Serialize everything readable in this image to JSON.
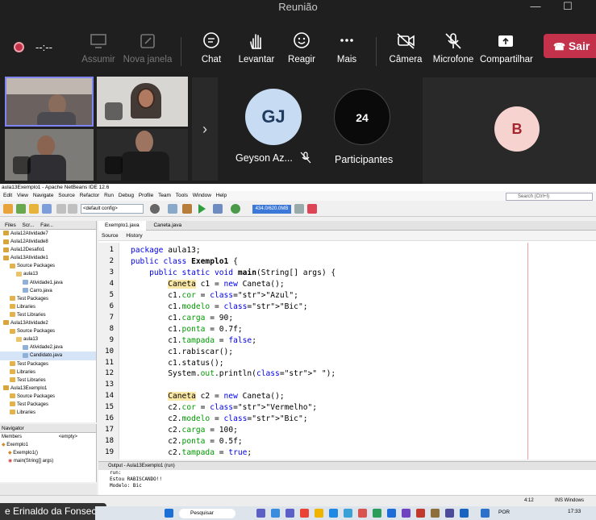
{
  "window": {
    "title": "Reunião",
    "minimize": "—",
    "maximize": "☐"
  },
  "toolbar": {
    "timer": "--:--",
    "buttons": [
      {
        "label": "Assumir",
        "icon": "screen-icon",
        "disabled": true
      },
      {
        "label": "Nova janela",
        "icon": "popout-icon",
        "disabled": true
      },
      {
        "label": "Chat",
        "icon": "chat-icon",
        "disabled": false
      },
      {
        "label": "Levantar",
        "icon": "hand-icon",
        "disabled": false
      },
      {
        "label": "Reagir",
        "icon": "smile-icon",
        "disabled": false
      },
      {
        "label": "Mais",
        "icon": "more-icon",
        "disabled": false
      },
      {
        "label": "Câmera",
        "icon": "camera-off-icon",
        "disabled": false
      },
      {
        "label": "Microfone",
        "icon": "mic-off-icon",
        "disabled": false
      },
      {
        "label": "Compartilhar",
        "icon": "share-icon",
        "disabled": false
      }
    ],
    "leave_label": "Sair"
  },
  "participants": {
    "tile1_initials": "GJ",
    "tile1_name": "Geyson Az...",
    "count": "24",
    "count_label": "Participantes",
    "tile3_initial": "B",
    "colors": {
      "gj_bg": "#c7dbf2",
      "gj_fg": "#1f3a5f",
      "count_bg": "#0a0a0a",
      "b_bg": "#f6d3cf",
      "b_fg": "#a4262c"
    }
  },
  "netbeans": {
    "title": "aula13Exemplo1 - Apache NetBeans IDE 12.6",
    "menu": [
      "Edit",
      "View",
      "Navigate",
      "Source",
      "Refactor",
      "Run",
      "Debug",
      "Profile",
      "Team",
      "Tools",
      "Window",
      "Help"
    ],
    "search_placeholder": "Search (Ctrl+I)",
    "config": "<default config>",
    "memory": "434.0/620.0MB",
    "tree_tabs": [
      "Files",
      "Scr...",
      "Fav..."
    ],
    "tree": [
      {
        "label": "Aula12Atividade7",
        "depth": 0,
        "kind": "project"
      },
      {
        "label": "Aula12Atividade8",
        "depth": 0,
        "kind": "project"
      },
      {
        "label": "Aula12Desafio1",
        "depth": 0,
        "kind": "project"
      },
      {
        "label": "Aula13Atividade1",
        "depth": 0,
        "kind": "project"
      },
      {
        "label": "Source Packages",
        "depth": 1,
        "kind": "folder"
      },
      {
        "label": "aula13",
        "depth": 2,
        "kind": "package"
      },
      {
        "label": "Atividade1.java",
        "depth": 3,
        "kind": "file"
      },
      {
        "label": "Carro.java",
        "depth": 3,
        "kind": "file"
      },
      {
        "label": "Test Packages",
        "depth": 1,
        "kind": "folder"
      },
      {
        "label": "Libraries",
        "depth": 1,
        "kind": "folder"
      },
      {
        "label": "Test Libraries",
        "depth": 1,
        "kind": "folder"
      },
      {
        "label": "Aula13Atividade2",
        "depth": 0,
        "kind": "project"
      },
      {
        "label": "Source Packages",
        "depth": 1,
        "kind": "folder"
      },
      {
        "label": "aula13",
        "depth": 2,
        "kind": "package"
      },
      {
        "label": "Atividade2.java",
        "depth": 3,
        "kind": "file"
      },
      {
        "label": "Candidato.java",
        "depth": 3,
        "kind": "file"
      },
      {
        "label": "Test Packages",
        "depth": 1,
        "kind": "folder"
      },
      {
        "label": "Libraries",
        "depth": 1,
        "kind": "folder"
      },
      {
        "label": "Test Libraries",
        "depth": 1,
        "kind": "folder"
      },
      {
        "label": "Aula13Exemplo1",
        "depth": 0,
        "kind": "project"
      },
      {
        "label": "Source Packages",
        "depth": 1,
        "kind": "folder"
      },
      {
        "label": "Test Packages",
        "depth": 1,
        "kind": "folder"
      },
      {
        "label": "Libraries",
        "depth": 1,
        "kind": "folder"
      }
    ],
    "navigator": {
      "title": "Navigator",
      "filter_left": "Members",
      "filter_right": "<empty>",
      "items": [
        "Exemplo1",
        "Exemplo1()",
        "main(String[] args)"
      ]
    },
    "editor_tabs": [
      "Exemplo1.java",
      "Caneta.java"
    ],
    "editor_toolbar": [
      "Source",
      "History"
    ],
    "lines": [
      "package aula13;",
      "public class Exemplo1 {",
      "    public static void main(String[] args) {",
      "        Caneta c1 = new Caneta();",
      "        c1.cor = \"Azul\";",
      "        c1.modelo = \"Bic\";",
      "        c1.carga = 90;",
      "        c1.ponta = 0.7f;",
      "        c1.tampada = false;",
      "        c1.rabiscar();",
      "        c1.status();",
      "        System.out.println(\" \");",
      "",
      "        Caneta c2 = new Caneta();",
      "        c2.cor = \"Vermelho\";",
      "        c2.modelo = \"Bic\";",
      "        c2.carga = 100;",
      "        c2.ponta = 0.5f;",
      "        c2.tampada = true;"
    ],
    "output": {
      "tab": "Output - Aula13Exemplo1 (run)",
      "lines": [
        "run:",
        "Estou RABISCANDO!!",
        "Modelo: Bic"
      ]
    },
    "status": {
      "position": "4:12",
      "mode": "INS Windows (CRLF)"
    }
  },
  "presenter_name": "e Erinaldo da Fonseca",
  "taskbar": {
    "search_label": "Pesquisar",
    "lang": "POR",
    "time": "17:33"
  }
}
